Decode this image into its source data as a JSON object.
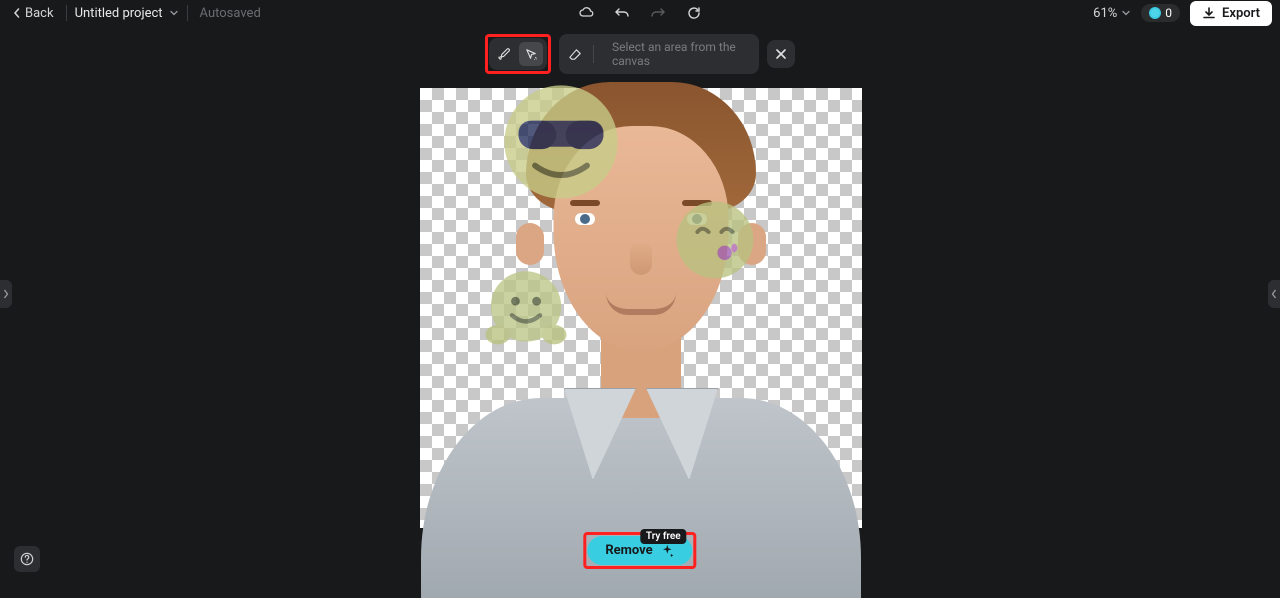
{
  "header": {
    "back_label": "Back",
    "project_title": "Untitled project",
    "autosaved_label": "Autosaved",
    "zoom_label": "61%",
    "credits_value": "0",
    "export_label": "Export"
  },
  "toolbar": {
    "prompt_placeholder": "Select an area from the canvas"
  },
  "action": {
    "remove_label": "Remove",
    "try_free_label": "Try free"
  },
  "icons": {
    "brush": "brush-icon",
    "ai_select": "ai-select-icon",
    "eraser": "eraser-icon",
    "close": "close-icon",
    "home": "cloud-icon",
    "undo": "undo-icon",
    "redo": "redo-icon",
    "reload": "reload-icon",
    "chevron_down": "chevron-down-icon",
    "download": "download-icon",
    "help": "help-icon",
    "sparkle": "sparkle-icon"
  }
}
